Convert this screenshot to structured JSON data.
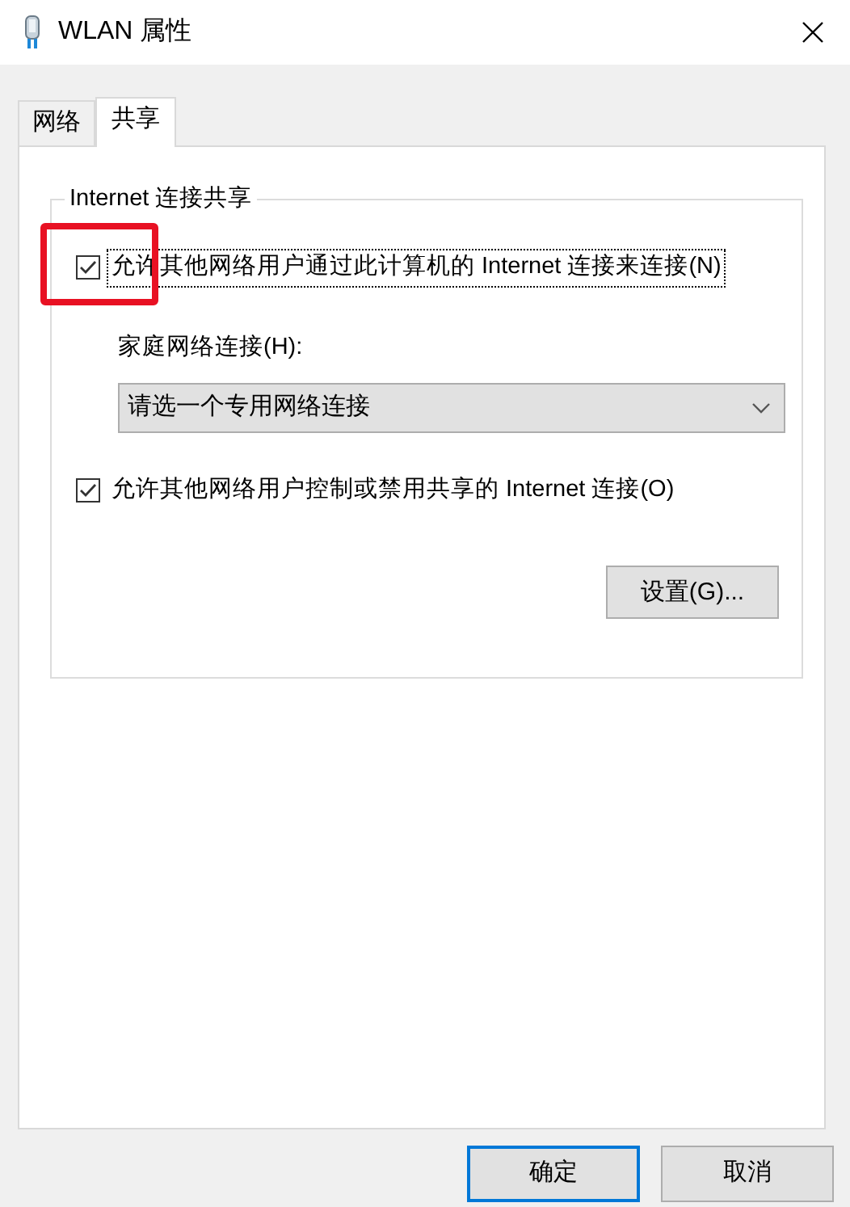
{
  "window": {
    "title": "WLAN 属性"
  },
  "tabs": [
    {
      "label": "网络",
      "selected": false
    },
    {
      "label": "共享",
      "selected": true
    }
  ],
  "group": {
    "title": "Internet 连接共享",
    "allow_sharing": {
      "label": "允许其他网络用户通过此计算机的 Internet 连接来连接(N)",
      "checked": true,
      "focused": true
    },
    "home_network": {
      "label": "家庭网络连接(H):",
      "value": "请选一个专用网络连接"
    },
    "allow_control": {
      "label": "允许其他网络用户控制或禁用共享的 Internet 连接(O)",
      "checked": true,
      "focused": false
    },
    "settings_button": "设置(G)..."
  },
  "buttons": [
    {
      "label": "确定",
      "default": true
    },
    {
      "label": "取消",
      "default": false
    }
  ]
}
